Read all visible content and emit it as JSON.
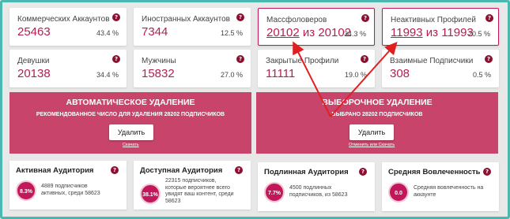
{
  "stats": [
    {
      "label": "Коммерческих Аккаунтов",
      "value": "25463",
      "pct": "43.4 %"
    },
    {
      "label": "Иностранных Аккаунтов",
      "value": "7344",
      "pct": "12.5 %"
    },
    {
      "label": "Массфоловеров",
      "value_a": "20102",
      "value_mid": " из ",
      "value_b": "20102",
      "pct": "34.3 %"
    },
    {
      "label": "Неактивных Профилей",
      "value_a": "11993",
      "value_mid": " из ",
      "value_b": "11993",
      "pct": "20.5 %"
    },
    {
      "label": "Девушки",
      "value": "20138",
      "pct": "34.4 %"
    },
    {
      "label": "Мужчины",
      "value": "15832",
      "pct": "27.0 %"
    },
    {
      "label": "Закрытые Профили",
      "value": "11111",
      "pct": "19.0 %"
    },
    {
      "label": "Взаимные Подписчики",
      "value": "308",
      "pct": "0.5 %"
    }
  ],
  "help_glyph": "?",
  "auto_delete": {
    "title": "АВТОМАТИЧЕСКОЕ УДАЛЕНИЕ",
    "subtitle": "РЕКОМЕНДОВАННОЕ ЧИСЛО ДЛЯ УДАЛЕНИЯ 28202 ПОДПИСЧИКОВ",
    "button": "Удалить",
    "link": "Скачать"
  },
  "selective_delete": {
    "title": "ВЫБОРОЧНОЕ УДАЛЕНИЕ",
    "subtitle": "ВЫБРАНО 28202 ПОДПИСЧИКОВ",
    "button": "Удалить",
    "link_a": "Отменить",
    "link_mid": "или",
    "link_b": "Скачать"
  },
  "audience": [
    {
      "title": "Активная Аудитория",
      "badge": "8.3%",
      "desc": [
        "4889 подписчиков",
        "активных, среди 58623"
      ]
    },
    {
      "title": "Доступная Аудитория",
      "badge": "38.1%",
      "desc": [
        "22315 подписчиков,",
        "которые вероятнее всего",
        "увидят ваш контент, среди",
        "58623"
      ]
    },
    {
      "title": "Подлинная Аудитория",
      "badge": "7.7%",
      "desc": [
        "4500 подлинных",
        "подписчиков, из 58623"
      ]
    },
    {
      "title": "Средняя Вовлеченность",
      "badge": "0.0",
      "desc": [
        "Средняя вовлеченность на",
        "аккаунте"
      ]
    }
  ],
  "colors": {
    "accent": "#b0224f",
    "panel": "#c9446b",
    "arrow": "#e02020",
    "frame": "#4ab8b0"
  }
}
